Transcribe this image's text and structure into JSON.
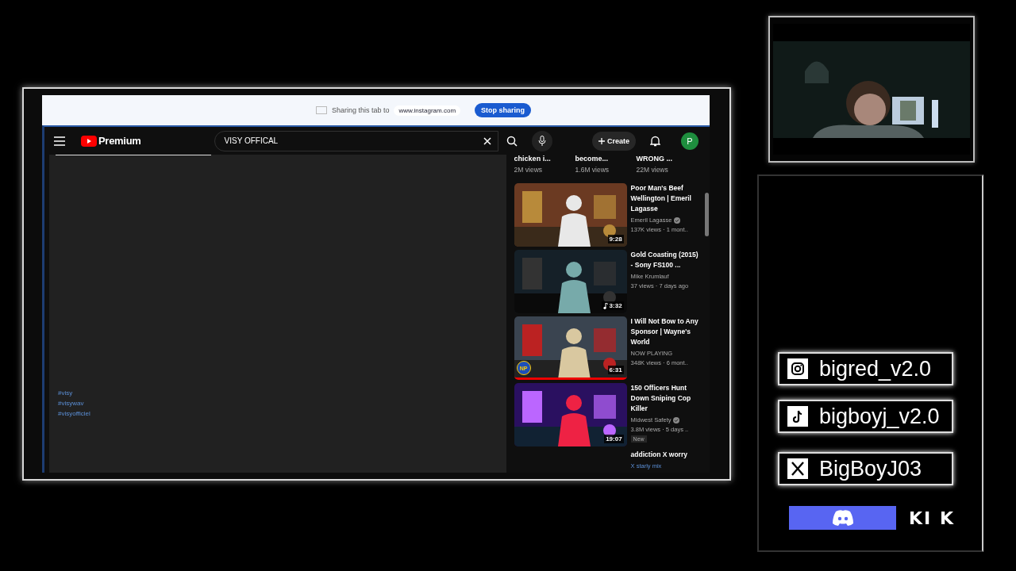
{
  "share_bar": {
    "message": "Sharing this tab to",
    "site": "www.instagram.com",
    "button": "Stop sharing"
  },
  "youtube": {
    "brand": "Premium",
    "search": {
      "value": "VISY OFFICAL"
    },
    "create": "Create",
    "avatar": "P",
    "hashtags": [
      "#visy",
      "#visywav",
      "#visyofficiel"
    ],
    "top_row": [
      {
        "title": "chicken i...",
        "views": "2M views"
      },
      {
        "title": "become...",
        "views": "1.6M views"
      },
      {
        "title": "WRONG ...",
        "views": "22M views"
      }
    ],
    "videos": [
      {
        "kind": "cooking",
        "title": "Poor Man's Beef Wellington | Emeril Lagasse",
        "channel": "Emeril Lagasse",
        "verified": true,
        "meta": "137K views · 1 mont..",
        "duration": "9:28",
        "music": false,
        "now_playing": false
      },
      {
        "kind": "street",
        "title": "Gold Coasting (2015) - Sony FS100 ...",
        "channel": "Mike Krumlauf",
        "verified": false,
        "meta": "37 views · 7 days ago",
        "duration": "3:32",
        "music": true,
        "now_playing": false
      },
      {
        "kind": "pizza",
        "title": "I Will Not Bow to Any Sponsor | Wayne's World",
        "channel": "NOW PLAYING",
        "verified": false,
        "meta": "348K views · 6 mont..",
        "duration": "6:31",
        "music": false,
        "now_playing": true,
        "badge": "NP"
      },
      {
        "kind": "police",
        "title": "150 Officers Hunt Down Sniping Cop Killer",
        "channel": "Midwest Safety",
        "verified": true,
        "meta": "3.8M views · 5 days ..",
        "duration": "19:07",
        "music": false,
        "now_playing": false,
        "tag": "New"
      }
    ],
    "partial_video": {
      "title": "addiction X worry",
      "channel": "X starly mix"
    }
  },
  "socials": [
    {
      "kind": "instagram",
      "handle": "bigred_v2.0"
    },
    {
      "kind": "tiktok",
      "handle": "bigboyj_v2.0"
    },
    {
      "kind": "x",
      "handle": "BigBoyJ03"
    }
  ],
  "kick": "KI K"
}
